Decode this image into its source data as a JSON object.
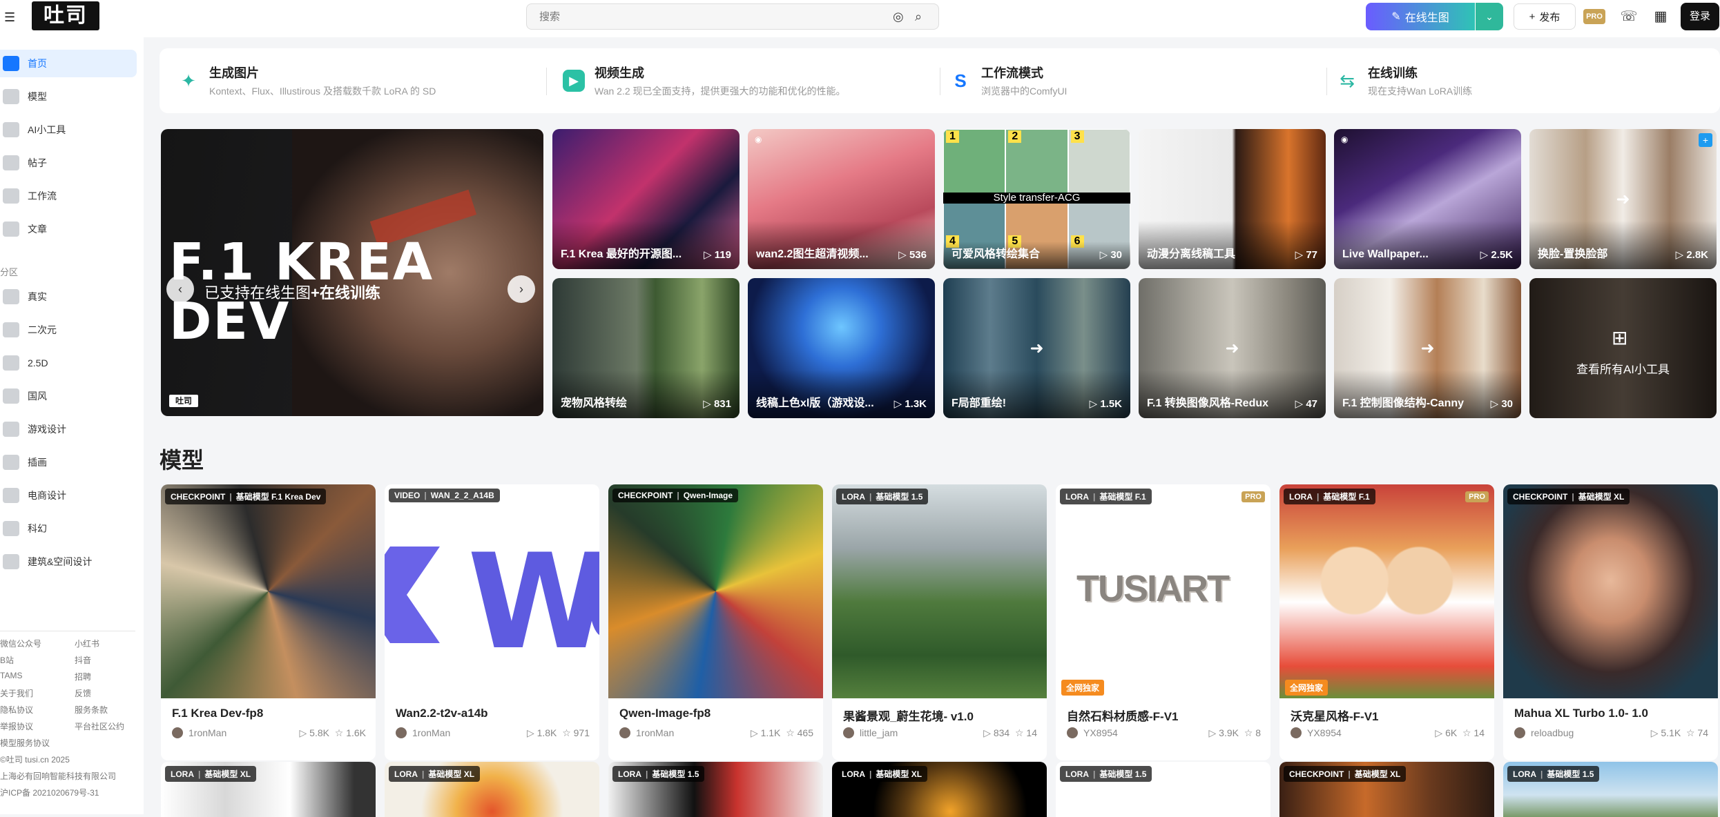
{
  "header": {
    "logo_text": "吐司",
    "search_placeholder": "搜索",
    "generate_label": "在线生图",
    "publish_label": "发布",
    "pro_label": "PRO",
    "login_label": "登录"
  },
  "sidebar": {
    "items": [
      {
        "label": "首页",
        "icon": "home-icon"
      },
      {
        "label": "模型",
        "icon": "cube-icon"
      },
      {
        "label": "AI小工具",
        "icon": "tool-icon"
      },
      {
        "label": "帖子",
        "icon": "post-icon"
      },
      {
        "label": "工作流",
        "icon": "workflow-icon"
      },
      {
        "label": "文章",
        "icon": "article-icon"
      }
    ],
    "section_label": "分区",
    "sections": [
      {
        "label": "真实"
      },
      {
        "label": "二次元"
      },
      {
        "label": "2.5D"
      },
      {
        "label": "国风"
      },
      {
        "label": "游戏设计"
      },
      {
        "label": "插画"
      },
      {
        "label": "电商设计"
      },
      {
        "label": "科幻"
      },
      {
        "label": "建筑&空间设计"
      }
    ],
    "footer": [
      "微信公众号",
      "小红书",
      "B站",
      "抖音",
      "TAMS",
      "招聘",
      "关于我们",
      "反馈",
      "隐私协议",
      "服务条款",
      "举报协议",
      "平台社区公约",
      "模型服务协议",
      "©吐司 tusi.cn 2025",
      "上海必有回响智能科技有限公司",
      "沪ICP备 2021020679号-31"
    ]
  },
  "features": [
    {
      "title": "生成图片",
      "sub": "Kontext、Flux、Illustirous 及搭载数千款 LoRA 的 SD",
      "icon": "wand-icon"
    },
    {
      "title": "视频生成",
      "sub": "Wan 2.2 现已全面支持，提供更强大的功能和优化的性能。",
      "icon": "video-icon"
    },
    {
      "title": "工作流模式",
      "sub": "浏览器中的ComfyUI",
      "icon": "workflow-s-icon"
    },
    {
      "title": "在线训练",
      "sub": "现在支持Wan LoRA训练",
      "icon": "train-icon"
    }
  ],
  "hero": {
    "title": "F.1 KREA DEV",
    "subtitle_prefix": "已支持在线生图",
    "subtitle_bold": "+在线训练",
    "logo": "吐司"
  },
  "tools": [
    {
      "label": "F.1 Krea 最好的开源图...",
      "count": "▷ 119"
    },
    {
      "label": "wan2.2图生超清视频...",
      "count": "▷ 536"
    },
    {
      "label": "可爱风格转绘集合",
      "count": "▷ 30",
      "band": "Style transfer-ACG",
      "nums": [
        "1",
        "2",
        "3",
        "4",
        "5",
        "6"
      ]
    },
    {
      "label": "动漫分离线稿工具",
      "count": "▷ 77"
    },
    {
      "label": "Live Wallpaper...",
      "count": "▷ 2.5K"
    },
    {
      "label": "换脸-置换脸部",
      "count": "▷ 2.8K"
    },
    {
      "label": "宠物风格转绘",
      "count": "▷ 831"
    },
    {
      "label": "线稿上色xl版（游戏设...",
      "count": "▷ 1.3K"
    },
    {
      "label": "F局部重绘!",
      "count": "▷ 1.5K"
    },
    {
      "label": "F.1 转换图像风格-Redux",
      "count": "▷ 47"
    },
    {
      "label": "F.1 控制图像结构-Canny",
      "count": "▷ 30"
    },
    {
      "label": "查看所有AI小工具",
      "count": ""
    }
  ],
  "models_title": "模型",
  "models": [
    {
      "type": "CHECKPOINT",
      "base": "基础模型 F.1 Krea Dev",
      "name": "F.1 Krea Dev-fp8",
      "author": "1ronMan",
      "runs": "▷ 5.8K",
      "stars": "☆ 1.6K"
    },
    {
      "type": "VIDEO",
      "base": "WAN_2_2_A14B",
      "name": "Wan2.2-t2v-a14b",
      "author": "1ronMan",
      "runs": "▷ 1.8K",
      "stars": "☆ 971"
    },
    {
      "type": "CHECKPOINT",
      "base": "Qwen-Image",
      "name": "Qwen-Image-fp8",
      "author": "1ronMan",
      "runs": "▷ 1.1K",
      "stars": "☆ 465"
    },
    {
      "type": "LORA",
      "base": "基础模型 1.5",
      "name": "果酱景观_蔚生花境- v1.0",
      "author": "little_jam",
      "runs": "▷ 834",
      "stars": "☆ 14"
    },
    {
      "type": "LORA",
      "base": "基础模型 F.1",
      "name": "自然石料材质感-F-V1",
      "author": "YX8954",
      "runs": "▷ 3.9K",
      "stars": "☆ 8",
      "pro": "PRO",
      "exclusive": "全网独家"
    },
    {
      "type": "LORA",
      "base": "基础模型 F.1",
      "name": "沃克星风格-F-V1",
      "author": "YX8954",
      "runs": "▷ 6K",
      "stars": "☆ 14",
      "pro": "PRO",
      "exclusive": "全网独家"
    },
    {
      "type": "CHECKPOINT",
      "base": "基础模型 XL",
      "name": "Mahua XL Turbo 1.0- 1.0",
      "author": "reloadbug",
      "runs": "▷ 5.1K",
      "stars": "☆ 74"
    }
  ],
  "models_row2": [
    {
      "type": "LORA",
      "base": "基础模型 XL"
    },
    {
      "type": "LORA",
      "base": "基础模型 XL"
    },
    {
      "type": "LORA",
      "base": "基础模型 1.5"
    },
    {
      "type": "LORA",
      "base": "基础模型 XL"
    },
    {
      "type": "LORA",
      "base": "基础模型 1.5"
    },
    {
      "type": "CHECKPOINT",
      "base": "基础模型 XL"
    },
    {
      "type": "LORA",
      "base": "基础模型 1.5"
    }
  ],
  "image_text": {
    "wan_logo": "W",
    "tusiart_wordmark": "TUSIART"
  }
}
